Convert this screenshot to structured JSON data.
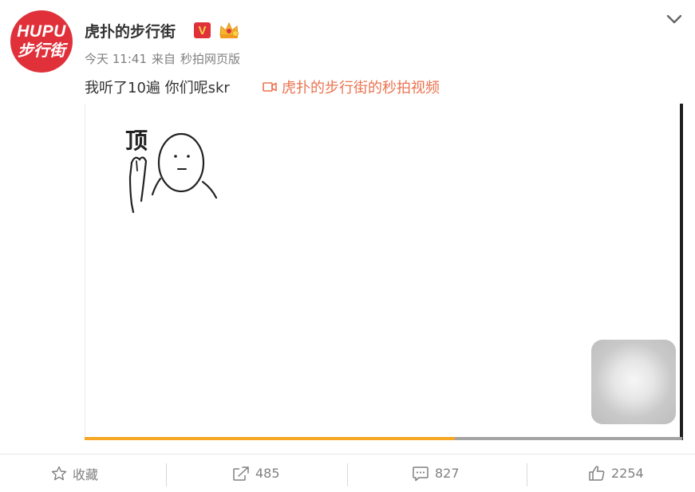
{
  "header": {
    "avatar_line1": "HUPU",
    "avatar_line2": "步行街",
    "username": "虎扑的步行街",
    "verified_badge": "V",
    "badge_icon": "crown-icon",
    "menu_icon": "chevron-down-icon",
    "timestamp": "今天 11:41",
    "source_prefix": "来自",
    "source": "秒拍网页版"
  },
  "post": {
    "text": "我听了10遍 你们呢skr",
    "video_link_icon": "video-camera-icon",
    "video_link": "虎扑的步行街的秒拍视频"
  },
  "video": {
    "sketch_caption": "顶",
    "play_icon": "play-button",
    "progress": 0.62
  },
  "actions": {
    "favorite": "收藏",
    "share": "485",
    "comment": "827",
    "like": "2254"
  },
  "colors": {
    "brand_red": "#e0313a",
    "link_orange": "#eb7350",
    "progress_orange": "#f5a623"
  }
}
